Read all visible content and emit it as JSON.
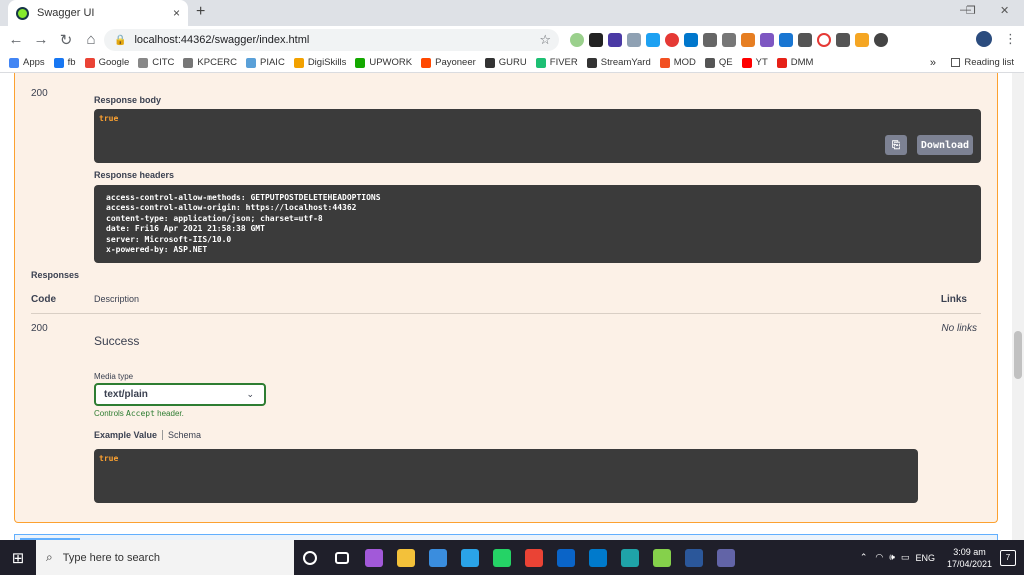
{
  "browser": {
    "tab_title": "Swagger UI",
    "tab_close": "×",
    "new_tab": "+",
    "url": "localhost:44362/swagger/index.html",
    "window_min": "—",
    "window_restore": "❐",
    "window_close": "✕",
    "bookmarks": [
      {
        "label": "Apps",
        "color": "#4285f4"
      },
      {
        "label": "fb",
        "color": "#1877f2"
      },
      {
        "label": "Google",
        "color": "#ea4335"
      },
      {
        "label": "CITC",
        "color": "#888888"
      },
      {
        "label": "KPCERC",
        "color": "#777777"
      },
      {
        "label": "PIAIC",
        "color": "#5aa0d8"
      },
      {
        "label": "DigiSkills",
        "color": "#f2a100"
      },
      {
        "label": "UPWORK",
        "color": "#14a800"
      },
      {
        "label": "Payoneer",
        "color": "#ff4800"
      },
      {
        "label": "GURU",
        "color": "#333333"
      },
      {
        "label": "FIVER",
        "color": "#1dbf73"
      },
      {
        "label": "StreamYard",
        "color": "#333333"
      },
      {
        "label": "MOD",
        "color": "#f25022"
      },
      {
        "label": "QE",
        "color": "#555555"
      },
      {
        "label": "YT",
        "color": "#ff0000"
      },
      {
        "label": "DMM",
        "color": "#e62117"
      }
    ],
    "bookmarks_more": "»",
    "reading_list": "Reading list"
  },
  "swagger": {
    "response_code": "200",
    "response_body_label": "Response body",
    "response_body": "true",
    "download_label": "Download",
    "response_headers_label": "Response headers",
    "response_headers": [
      "access-control-allow-methods: GETPUTPOSTDELETEHEADOPTIONS",
      "access-control-allow-origin: https://localhost:44362",
      "content-type: application/json; charset=utf-8",
      "date: Fri16 Apr 2021 21:58:38 GMT",
      "server: Microsoft-IIS/10.0",
      "x-powered-by: ASP.NET"
    ],
    "responses_title": "Responses",
    "col_code": "Code",
    "col_description": "Description",
    "col_links": "Links",
    "resp_code": "200",
    "resp_description": "Success",
    "resp_links": "No links",
    "media_type_label": "Media type",
    "media_type_value": "text/plain",
    "controls_prefix": "Controls ",
    "controls_code": "Accept",
    "controls_suffix": " header.",
    "example_tab": "Example Value",
    "schema_tab": "Schema",
    "example_body": "true"
  },
  "taskbar": {
    "search_placeholder": "Type here to search",
    "language": "ENG",
    "time": "3:09 am",
    "date": "17/04/2021",
    "notifications": "7",
    "apps": [
      {
        "name": "cortana",
        "color": "#ffffff"
      },
      {
        "name": "task-view",
        "color": "#ffffff"
      },
      {
        "name": "visual-studio",
        "color": "#a259d9"
      },
      {
        "name": "file-explorer",
        "color": "#f3c13a"
      },
      {
        "name": "app",
        "color": "#3a8dde"
      },
      {
        "name": "app2",
        "color": "#2aa3e8"
      },
      {
        "name": "whatsapp",
        "color": "#25d366"
      },
      {
        "name": "chrome",
        "color": "#ea4335"
      },
      {
        "name": "mail",
        "color": "#0a64c8"
      },
      {
        "name": "vscode",
        "color": "#007acc"
      },
      {
        "name": "edge",
        "color": "#1fa3a8"
      },
      {
        "name": "app3",
        "color": "#85d14b"
      },
      {
        "name": "word",
        "color": "#2b579a"
      },
      {
        "name": "teams",
        "color": "#6264a7"
      }
    ]
  }
}
